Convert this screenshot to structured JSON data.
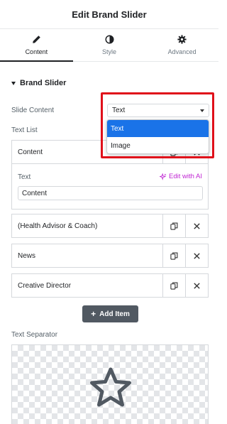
{
  "header": {
    "title": "Edit Brand Slider"
  },
  "tabs": [
    {
      "label": "Content",
      "icon": "pencil-icon",
      "active": true
    },
    {
      "label": "Style",
      "icon": "half-circle-icon",
      "active": false
    },
    {
      "label": "Advanced",
      "icon": "gear-icon",
      "active": false
    }
  ],
  "section": {
    "title": "Brand Slider"
  },
  "slide_content": {
    "label": "Slide Content",
    "value": "Text",
    "options": [
      "Text",
      "Image"
    ],
    "selected_option": "Text"
  },
  "text_list": {
    "label": "Text List",
    "items": [
      {
        "label": "Content"
      },
      {
        "label": "(Health Advisor & Coach)"
      },
      {
        "label": "News"
      },
      {
        "label": "Creative Director"
      }
    ],
    "open_item": {
      "field_label": "Text",
      "ai_label": "Edit with AI",
      "value": "Content"
    },
    "add_label": "Add Item"
  },
  "separator": {
    "label": "Text Separator",
    "icon": "star-icon"
  },
  "colors": {
    "accent": "#1a73e8",
    "ai": "#c026d3",
    "highlight": "#e0101a",
    "button": "#515962"
  }
}
